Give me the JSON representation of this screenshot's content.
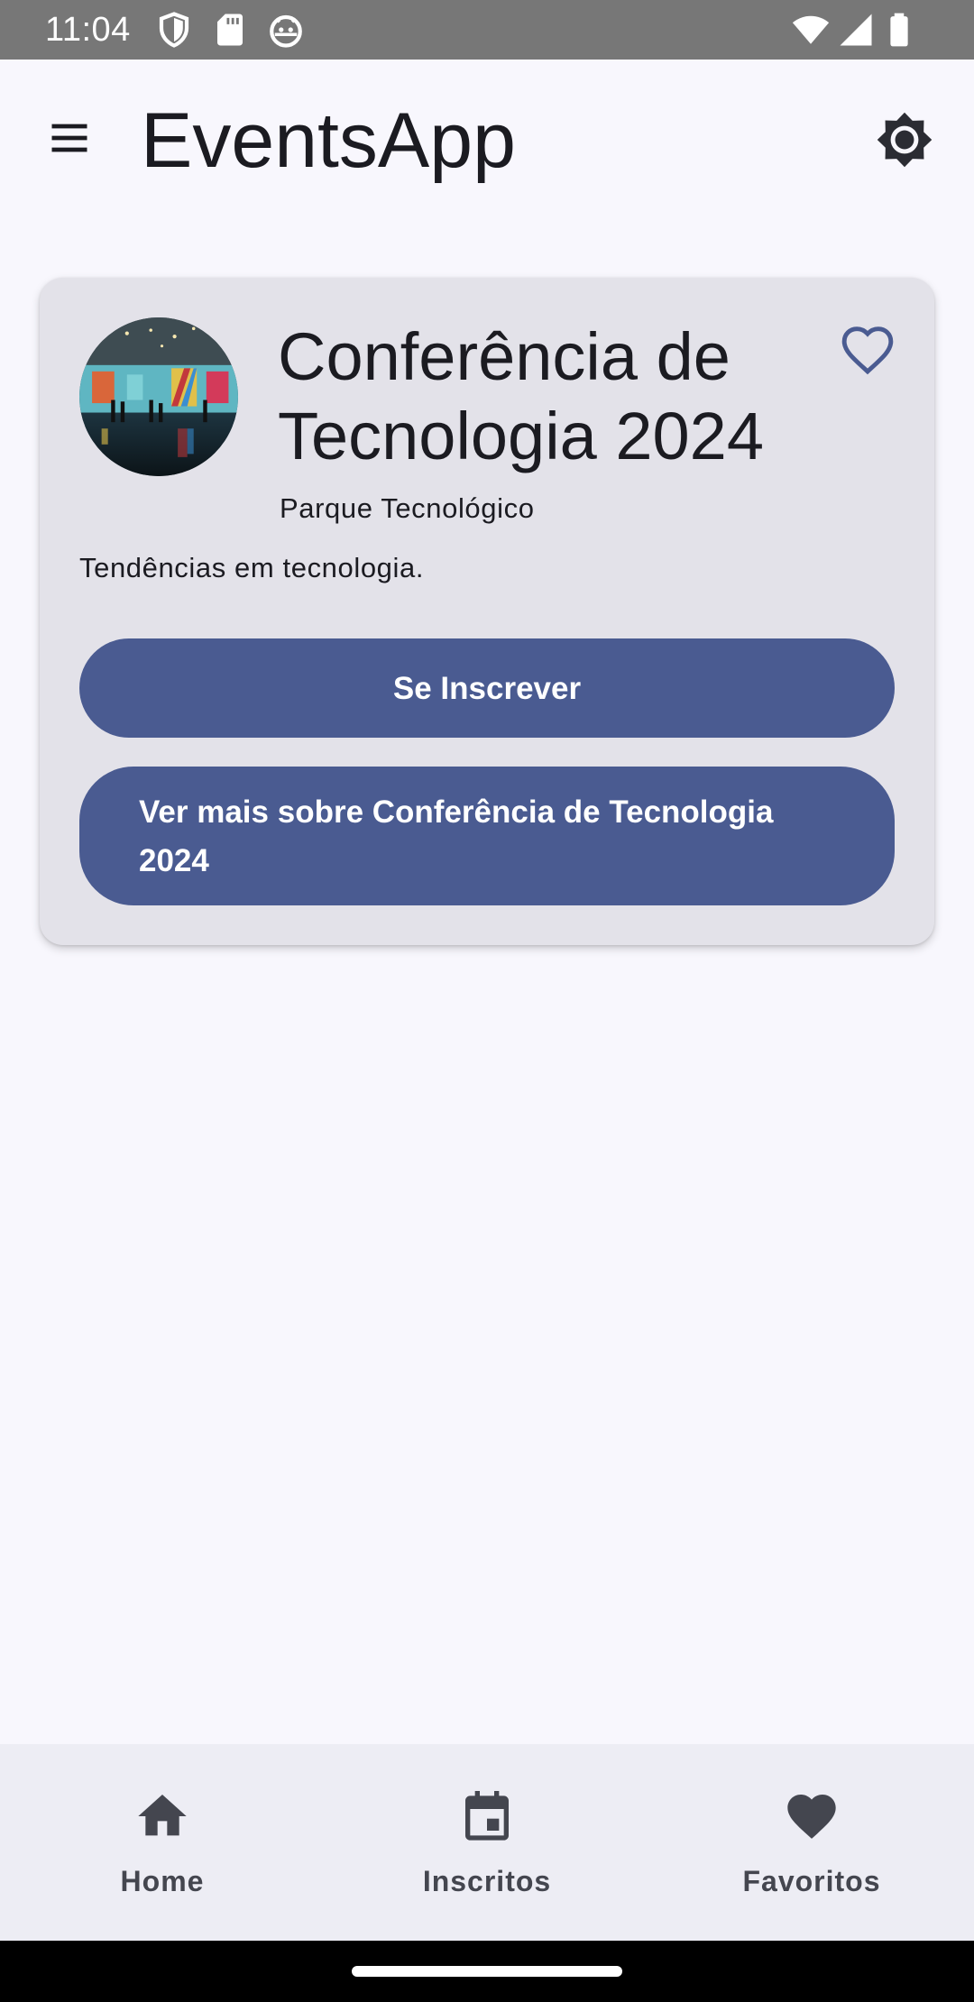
{
  "status_bar": {
    "time": "11:04",
    "left_icons": [
      "shield-icon",
      "sd-card-icon",
      "android-debug-icon"
    ],
    "right_icons": [
      "wifi-icon",
      "cellular-signal-icon",
      "battery-icon"
    ]
  },
  "app_bar": {
    "title": "EventsApp",
    "menu_icon": "menu-icon",
    "theme_icon": "brightness-icon"
  },
  "events": [
    {
      "title": "Conferência de Tecnologia 2024",
      "location": "Parque Tecnológico",
      "description": "Tendências em tecnologia.",
      "subscribe_label": "Se Inscrever",
      "more_label": "Ver mais sobre Conferência de Tecnologia 2024",
      "favorite_icon": "heart-outline-icon"
    }
  ],
  "bottom_nav": {
    "items": [
      {
        "label": "Home",
        "icon": "home-icon"
      },
      {
        "label": "Inscritos",
        "icon": "calendar-icon"
      },
      {
        "label": "Favoritos",
        "icon": "heart-icon"
      }
    ]
  },
  "colors": {
    "primary": "#4a5b91",
    "card_background": "#e3e2e9",
    "page_background": "#f8f7fd",
    "nav_background": "#ededf4",
    "status_bar": "#777777"
  }
}
